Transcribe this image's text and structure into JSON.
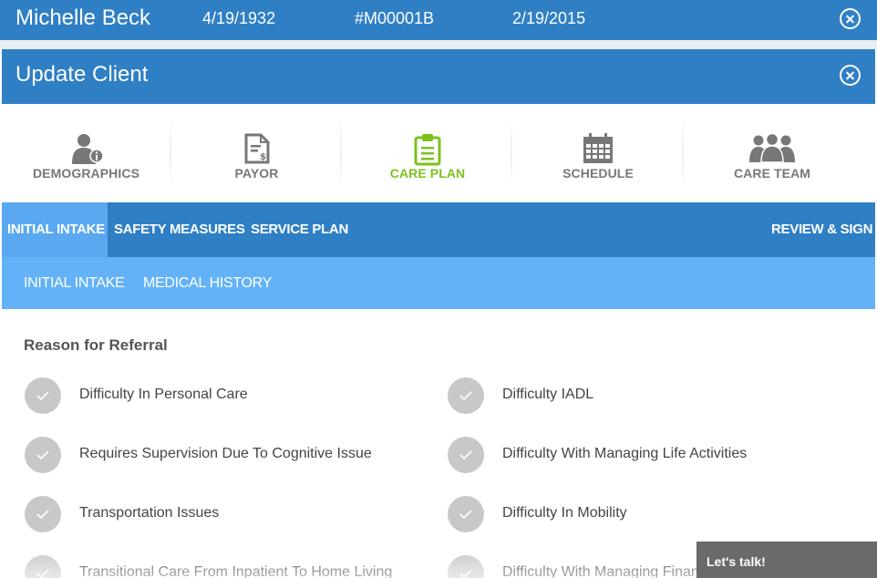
{
  "patient_bar": {
    "name": "Michelle Beck",
    "dob": "4/19/1932",
    "member_id": "#M00001B",
    "date": "2/19/2015"
  },
  "modal": {
    "title": "Update Client"
  },
  "main_tabs": [
    {
      "label": "DEMOGRAPHICS",
      "icon": "person-info-icon"
    },
    {
      "label": "PAYOR",
      "icon": "invoice-icon"
    },
    {
      "label": "CARE PLAN",
      "icon": "clipboard-icon"
    },
    {
      "label": "SCHEDULE",
      "icon": "calendar-icon"
    },
    {
      "label": "CARE TEAM",
      "icon": "people-group-icon"
    }
  ],
  "active_tab": "CARE PLAN",
  "sub_nav": {
    "items": [
      "INITIAL INTAKE",
      "SAFETY MEASURES",
      "SERVICE PLAN"
    ],
    "right": "REVIEW & SIGN"
  },
  "sub_sub_nav": [
    "INITIAL INTAKE",
    "MEDICAL HISTORY"
  ],
  "section": {
    "title": "Reason for Referral",
    "left_options": [
      "Difficulty In Personal Care",
      "Requires Supervision Due To Cognitive Issue",
      "Transportation Issues",
      "Transitional Care From Inpatient To Home Living"
    ],
    "right_options": [
      "Difficulty IADL",
      "Difficulty With Managing Life Activities",
      "Difficulty In Mobility",
      "Difficulty With Managing Finan"
    ]
  },
  "chat": {
    "label": "Let's talk!"
  },
  "colors": {
    "primary": "#2f7fc5",
    "subnav_light": "#63b2f7",
    "active_tab": "#7cc21d",
    "tab_text": "#777777",
    "check_bg": "#c8c8c8"
  }
}
